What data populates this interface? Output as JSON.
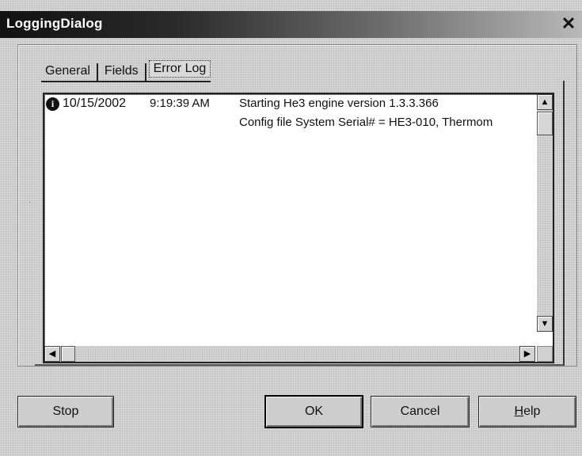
{
  "window": {
    "title": "LoggingDialog",
    "close_glyph": "✕"
  },
  "tabs": [
    {
      "label": "General"
    },
    {
      "label": "Fields"
    },
    {
      "label": "Error Log",
      "active": true
    }
  ],
  "log": {
    "rows": [
      {
        "icon": "info-icon",
        "date": "10/15/2002",
        "time": "9:19:39 AM",
        "message": "Starting He3 engine version 1.3.3.366"
      },
      {
        "icon": "",
        "date": "",
        "time": "",
        "message": "Config file System Serial# = HE3-010,  Thermom"
      }
    ]
  },
  "scrollbar": {
    "up": "▲",
    "down": "▼",
    "left": "◀",
    "right": "▶"
  },
  "buttons": {
    "stop": "Stop",
    "ok": "OK",
    "cancel": "Cancel",
    "help_prefix": "H",
    "help_rest": "elp"
  },
  "colors": {
    "title_start": "#111111",
    "title_end": "#b8b8b8",
    "face": "#cdcdcd",
    "log_background": "#ffffff"
  }
}
